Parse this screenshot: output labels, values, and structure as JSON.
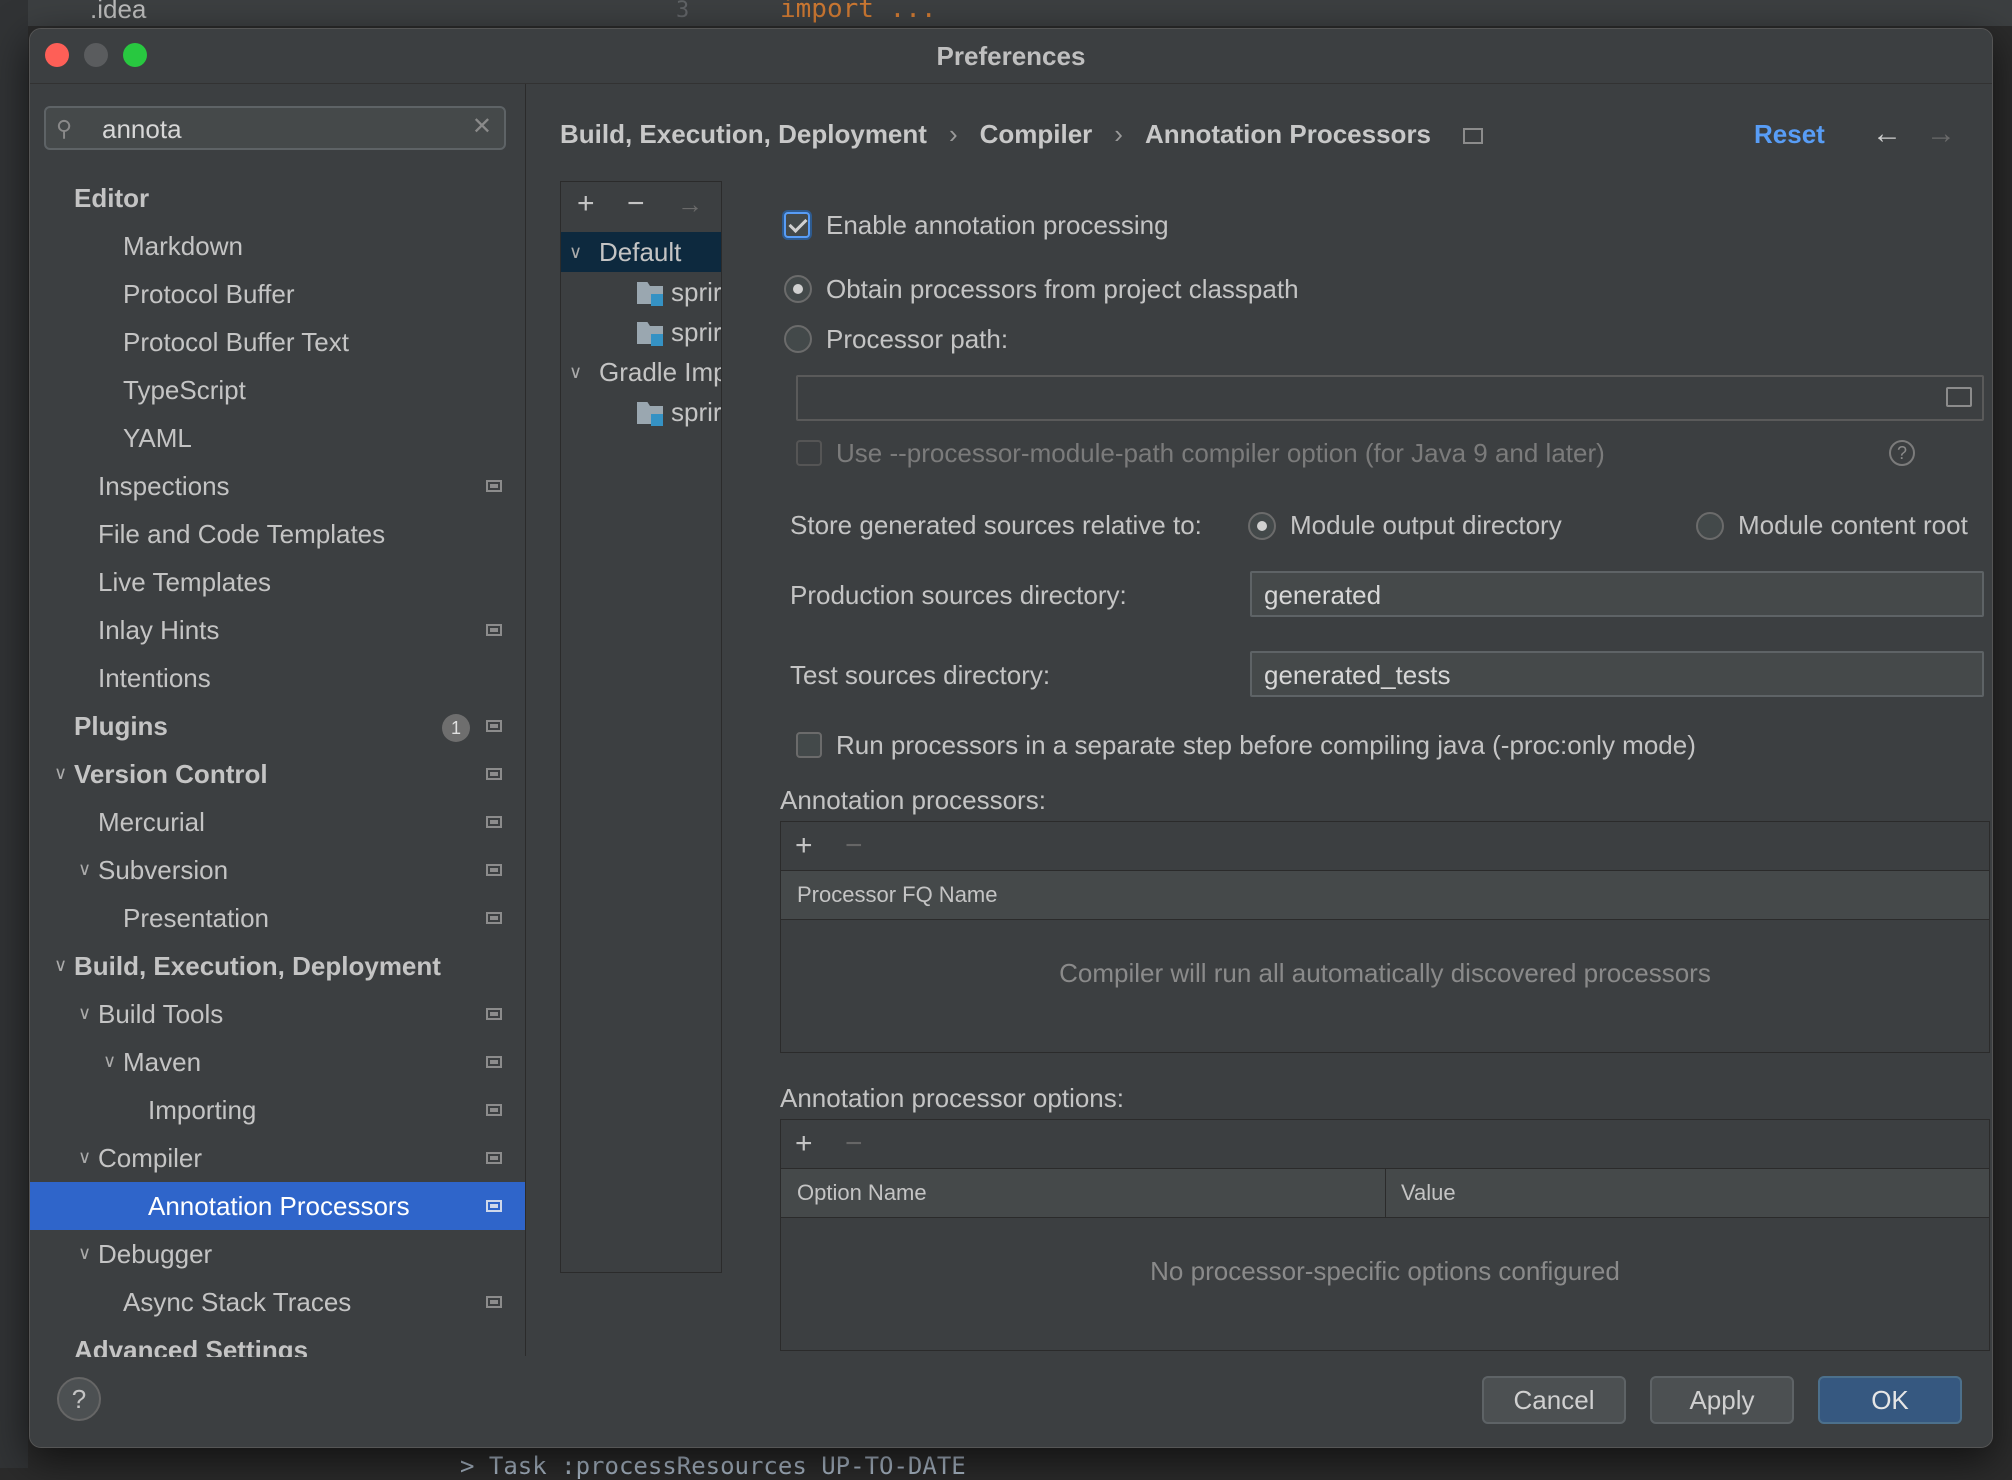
{
  "window": {
    "title": "Preferences"
  },
  "background": {
    "folder_label": ".idea",
    "code_keyword": "import",
    "code_ellipsis": "...",
    "line_number": "3",
    "console_text": "> Task :processResources UP-TO-DATE"
  },
  "search": {
    "value": "annota"
  },
  "sidebar": {
    "items": [
      {
        "label": "Editor"
      },
      {
        "label": "Markdown"
      },
      {
        "label": "Protocol Buffer"
      },
      {
        "label": "Protocol Buffer Text"
      },
      {
        "label": "TypeScript"
      },
      {
        "label": "YAML"
      },
      {
        "label": "Inspections"
      },
      {
        "label": "File and Code Templates"
      },
      {
        "label": "Live Templates"
      },
      {
        "label": "Inlay Hints"
      },
      {
        "label": "Intentions"
      },
      {
        "label": "Plugins",
        "badge": "1"
      },
      {
        "label": "Version Control"
      },
      {
        "label": "Mercurial"
      },
      {
        "label": "Subversion"
      },
      {
        "label": "Presentation"
      },
      {
        "label": "Build, Execution, Deployment"
      },
      {
        "label": "Build Tools"
      },
      {
        "label": "Maven"
      },
      {
        "label": "Importing"
      },
      {
        "label": "Compiler"
      },
      {
        "label": "Annotation Processors"
      },
      {
        "label": "Debugger"
      },
      {
        "label": "Async Stack Traces"
      },
      {
        "label": "Advanced Settings"
      }
    ]
  },
  "breadcrumb": [
    "Build, Execution, Deployment",
    "Compiler",
    "Annotation Processors"
  ],
  "header": {
    "reset_label": "Reset"
  },
  "profiles": {
    "items": [
      {
        "label": "Default"
      },
      {
        "label": "sprir"
      },
      {
        "label": "sprir"
      },
      {
        "label": "Gradle Imp"
      },
      {
        "label": "sprir"
      }
    ]
  },
  "settings": {
    "enable_label": "Enable annotation processing",
    "obtain_label": "Obtain processors from project classpath",
    "path_label": "Processor path:",
    "module_path_label": "Use --processor-module-path compiler option (for Java 9 and later)",
    "store_label": "Store generated sources relative to:",
    "module_output_label": "Module output directory",
    "module_content_label": "Module content root",
    "production_label": "Production sources directory:",
    "production_value": "generated",
    "test_label": "Test sources directory:",
    "test_value": "generated_tests",
    "separate_step_label": "Run processors in a separate step before compiling java (-proc:only mode)"
  },
  "processors_table": {
    "title": "Annotation processors:",
    "column": "Processor FQ Name",
    "empty": "Compiler will run all automatically discovered processors"
  },
  "options_table": {
    "title": "Annotation processor options:",
    "columns": [
      "Option Name",
      "Value"
    ],
    "empty": "No processor-specific options configured"
  },
  "footer": {
    "help": "?",
    "cancel": "Cancel",
    "apply": "Apply",
    "ok": "OK"
  }
}
